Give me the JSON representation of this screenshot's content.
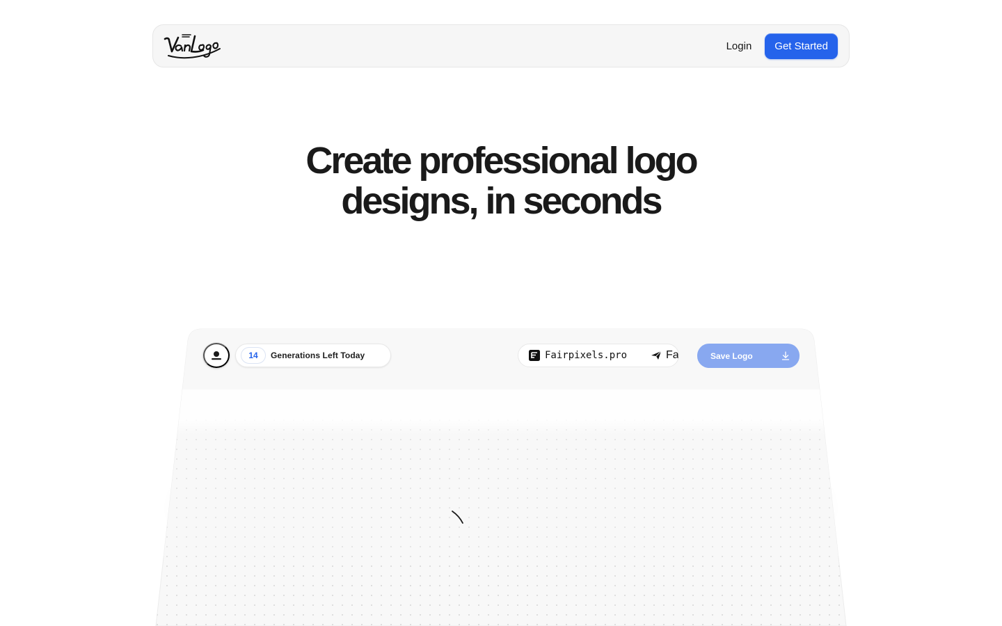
{
  "nav": {
    "logo_alt": "VanLogo",
    "login_label": "Login",
    "cta_label": "Get Started"
  },
  "hero": {
    "title": "Create professional logo designs, in seconds"
  },
  "preview": {
    "credits_count": "14",
    "credits_label": "Generations Left Today",
    "ticker": [
      {
        "text": "Fairpixels.pro",
        "icon": "fairpixels-icon"
      },
      {
        "text": "Fair",
        "icon": "paper-plane-icon"
      }
    ],
    "save_label": "Save Logo",
    "save_icon": "download-icon"
  },
  "colors": {
    "accent": "#2563eb",
    "accent_muted": "#88a8f0",
    "panel_bg": "#f8f8f8",
    "dot_grid": "#d6d6d6"
  }
}
